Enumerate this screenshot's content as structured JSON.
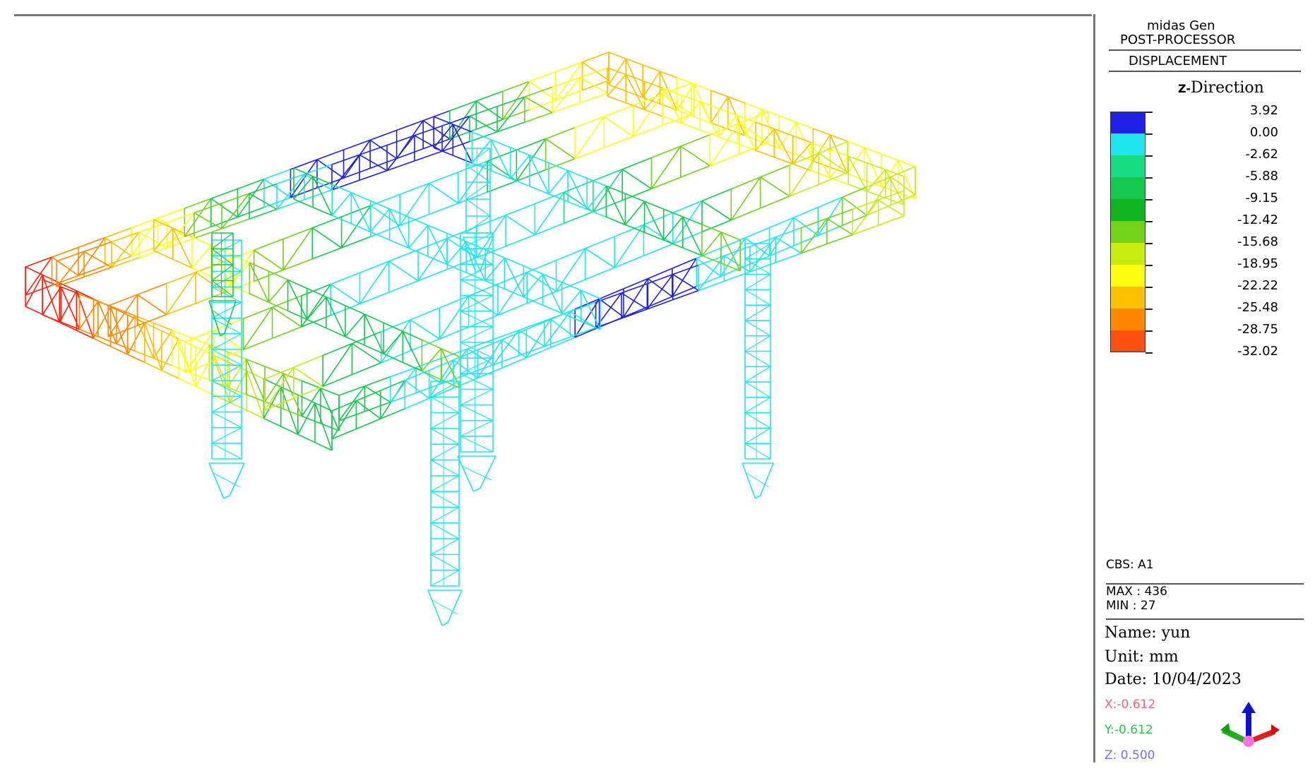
{
  "app": {
    "name": "midas Gen",
    "mode": "POST-PROCESSOR"
  },
  "result": {
    "type": "DISPLACEMENT",
    "component": "Z-Direction",
    "component_prefix": "Z-",
    "component_word": "Direction"
  },
  "legend": {
    "values": [
      "3.92",
      "0.00",
      "-2.62",
      "-5.88",
      "-9.15",
      "-12.42",
      "-15.68",
      "-18.95",
      "-22.22",
      "-25.48",
      "-28.75",
      "-32.02"
    ],
    "colors": [
      "#1f1fe6",
      "#1fe6f0",
      "#18dc84",
      "#14c850",
      "#10b420",
      "#72d21a",
      "#c8eb10",
      "#ffff10",
      "#ffc000",
      "#ff8800",
      "#ff5010",
      "#ff2010"
    ]
  },
  "info": {
    "cbs": "CBS: A1",
    "max": "MAX : 436",
    "min": "MIN : 27",
    "name": "Name: yun",
    "unit": "Unit: mm",
    "date": "Date: 10/04/2023"
  },
  "view_direction": {
    "x": "X:-0.612",
    "y": "Y:-0.612",
    "z": "Z: 0.500",
    "x_color": "#ff6070",
    "y_color": "#20d040",
    "z_color": "#7070ff"
  },
  "model": {
    "frame_colors": [
      "#ff2010",
      "#ff8800",
      "#ffc000",
      "#ffff10",
      "#c8eb10",
      "#72d21a",
      "#14c850",
      "#18dc84",
      "#1fe6f0",
      "#1f1fe6"
    ]
  }
}
